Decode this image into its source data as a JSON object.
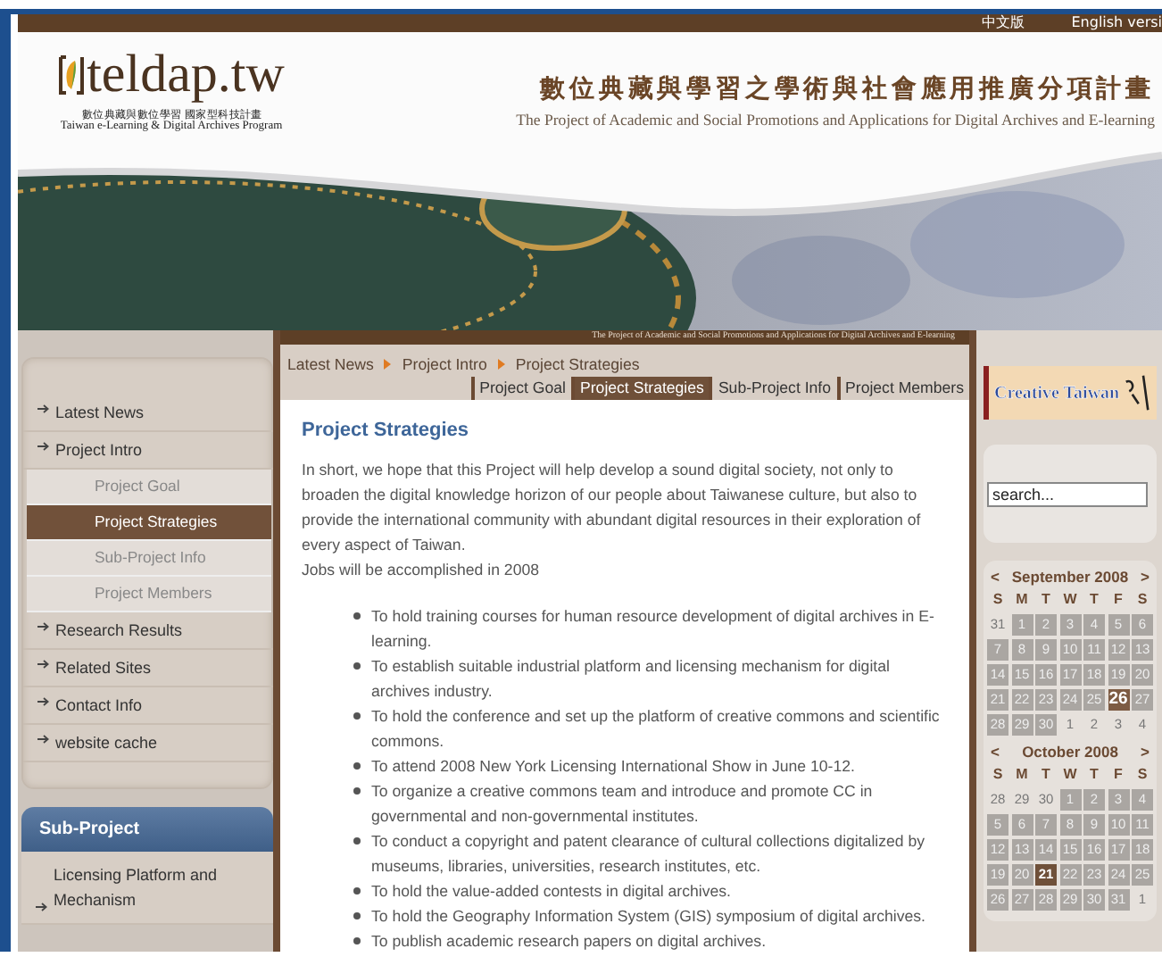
{
  "top_links": [
    "中文版",
    "English versi"
  ],
  "logo": {
    "name": "teldap.tw",
    "subtitle_zh": "數位典藏與數位學習 國家型科技計畫",
    "subtitle_en": "Taiwan e-Learning & Digital Archives Program"
  },
  "header": {
    "title_zh": "數位典藏與學習之學術與社會應用推廣分項計畫",
    "title_en": "The Project of Academic and Social Promotions and Applications for Digital Archives and E-learning"
  },
  "nav": {
    "items": [
      {
        "label": "Latest News"
      },
      {
        "label": "Project Intro",
        "children": [
          {
            "label": "Project Goal",
            "selected": false
          },
          {
            "label": "Project Strategies",
            "selected": true
          },
          {
            "label": "Sub-Project Info",
            "selected": false
          },
          {
            "label": "Project Members",
            "selected": false
          }
        ]
      },
      {
        "label": "Research Results"
      },
      {
        "label": "Related Sites"
      },
      {
        "label": "Contact Info"
      },
      {
        "label": "website cache"
      }
    ]
  },
  "sub_project": {
    "title": "Sub-Project",
    "items": [
      "Licensing Platform and Mechanism"
    ]
  },
  "main": {
    "strip_text": "The Project of Academic and Social Promotions and Applications for Digital Archives and E-learning",
    "breadcrumb": [
      "Latest News",
      "Project Intro",
      "Project Strategies"
    ],
    "tabs": [
      {
        "label": "Project Goal",
        "selected": false
      },
      {
        "label": "Project Strategies",
        "selected": true
      },
      {
        "label": "Sub-Project Info",
        "selected": false
      },
      {
        "label": "Project Members",
        "selected": false
      }
    ],
    "heading": "Project Strategies",
    "intro": "In short, we hope that this Project will help develop a sound digital society, not only to broaden the digital knowledge horizon of our people about Taiwanese culture, but also to provide the international community with abundant digital resources in their exploration of every aspect of Taiwan.",
    "note": "Jobs will be accomplished in 2008",
    "bullets": [
      "To hold training courses for human resource development of digital archives in E-learning.",
      "To establish suitable industrial platform and licensing mechanism for digital archives industry.",
      "To hold the conference and set up the platform of creative commons and scientific commons.",
      "To attend 2008 New York Licensing International Show in June 10-12.",
      "To organize a creative commons team and introduce and promote CC in governmental and non-governmental institutes.",
      "To conduct a copyright and patent clearance of cultural collections digitalized by museums, libraries, universities, research institutes, etc.",
      "To hold the value-added contests in digital archives.",
      "To hold the Geography Information System (GIS) symposium of digital archives.",
      "To publish academic research papers on digital archives."
    ]
  },
  "right": {
    "banner": "Creative Taiwan",
    "search": {
      "placeholder": "search..."
    },
    "calendars": [
      {
        "prev": "<",
        "title": "September 2008",
        "next": ">",
        "weekdays": [
          "S",
          "M",
          "T",
          "W",
          "T",
          "F",
          "S"
        ],
        "weeks": [
          [
            {
              "day": "31",
              "kind": "outside"
            },
            {
              "day": "1",
              "kind": "linked"
            },
            {
              "day": "2",
              "kind": "linked"
            },
            {
              "day": "3",
              "kind": "linked"
            },
            {
              "day": "4",
              "kind": "linked"
            },
            {
              "day": "5",
              "kind": "linked"
            },
            {
              "day": "6",
              "kind": "linked"
            }
          ],
          [
            {
              "day": "7",
              "kind": "linked"
            },
            {
              "day": "8",
              "kind": "linked"
            },
            {
              "day": "9",
              "kind": "linked"
            },
            {
              "day": "10",
              "kind": "linked"
            },
            {
              "day": "11",
              "kind": "linked"
            },
            {
              "day": "12",
              "kind": "linked"
            },
            {
              "day": "13",
              "kind": "linked"
            }
          ],
          [
            {
              "day": "14",
              "kind": "linked"
            },
            {
              "day": "15",
              "kind": "linked"
            },
            {
              "day": "16",
              "kind": "linked"
            },
            {
              "day": "17",
              "kind": "linked"
            },
            {
              "day": "18",
              "kind": "linked"
            },
            {
              "day": "19",
              "kind": "linked"
            },
            {
              "day": "20",
              "kind": "linked"
            }
          ],
          [
            {
              "day": "21",
              "kind": "linked"
            },
            {
              "day": "22",
              "kind": "linked"
            },
            {
              "day": "23",
              "kind": "linked"
            },
            {
              "day": "24",
              "kind": "linked"
            },
            {
              "day": "25",
              "kind": "linked"
            },
            {
              "day": "26",
              "kind": "today"
            },
            {
              "day": "27",
              "kind": "linked"
            }
          ],
          [
            {
              "day": "28",
              "kind": "linked"
            },
            {
              "day": "29",
              "kind": "linked"
            },
            {
              "day": "30",
              "kind": "linked"
            },
            {
              "day": "1",
              "kind": "outside"
            },
            {
              "day": "2",
              "kind": "outside"
            },
            {
              "day": "3",
              "kind": "outside"
            },
            {
              "day": "4",
              "kind": "outside"
            }
          ]
        ]
      },
      {
        "prev": "<",
        "title": "October 2008",
        "next": ">",
        "weekdays": [
          "S",
          "M",
          "T",
          "W",
          "T",
          "F",
          "S"
        ],
        "weeks": [
          [
            {
              "day": "28",
              "kind": "outside"
            },
            {
              "day": "29",
              "kind": "outside"
            },
            {
              "day": "30",
              "kind": "outside"
            },
            {
              "day": "1",
              "kind": "linked"
            },
            {
              "day": "2",
              "kind": "linked"
            },
            {
              "day": "3",
              "kind": "linked"
            },
            {
              "day": "4",
              "kind": "linked"
            }
          ],
          [
            {
              "day": "5",
              "kind": "linked"
            },
            {
              "day": "6",
              "kind": "linked"
            },
            {
              "day": "7",
              "kind": "linked"
            },
            {
              "day": "8",
              "kind": "linked"
            },
            {
              "day": "9",
              "kind": "linked"
            },
            {
              "day": "10",
              "kind": "linked"
            },
            {
              "day": "11",
              "kind": "linked"
            }
          ],
          [
            {
              "day": "12",
              "kind": "linked"
            },
            {
              "day": "13",
              "kind": "linked"
            },
            {
              "day": "14",
              "kind": "linked"
            },
            {
              "day": "15",
              "kind": "linked"
            },
            {
              "day": "16",
              "kind": "linked"
            },
            {
              "day": "17",
              "kind": "linked"
            },
            {
              "day": "18",
              "kind": "linked"
            }
          ],
          [
            {
              "day": "19",
              "kind": "linked"
            },
            {
              "day": "20",
              "kind": "linked"
            },
            {
              "day": "21",
              "kind": "marked"
            },
            {
              "day": "22",
              "kind": "linked"
            },
            {
              "day": "23",
              "kind": "linked"
            },
            {
              "day": "24",
              "kind": "linked"
            },
            {
              "day": "25",
              "kind": "linked"
            }
          ],
          [
            {
              "day": "26",
              "kind": "linked"
            },
            {
              "day": "27",
              "kind": "linked"
            },
            {
              "day": "28",
              "kind": "linked"
            },
            {
              "day": "29",
              "kind": "linked"
            },
            {
              "day": "30",
              "kind": "linked"
            },
            {
              "day": "31",
              "kind": "linked"
            },
            {
              "day": "1",
              "kind": "outside"
            }
          ]
        ]
      }
    ]
  }
}
